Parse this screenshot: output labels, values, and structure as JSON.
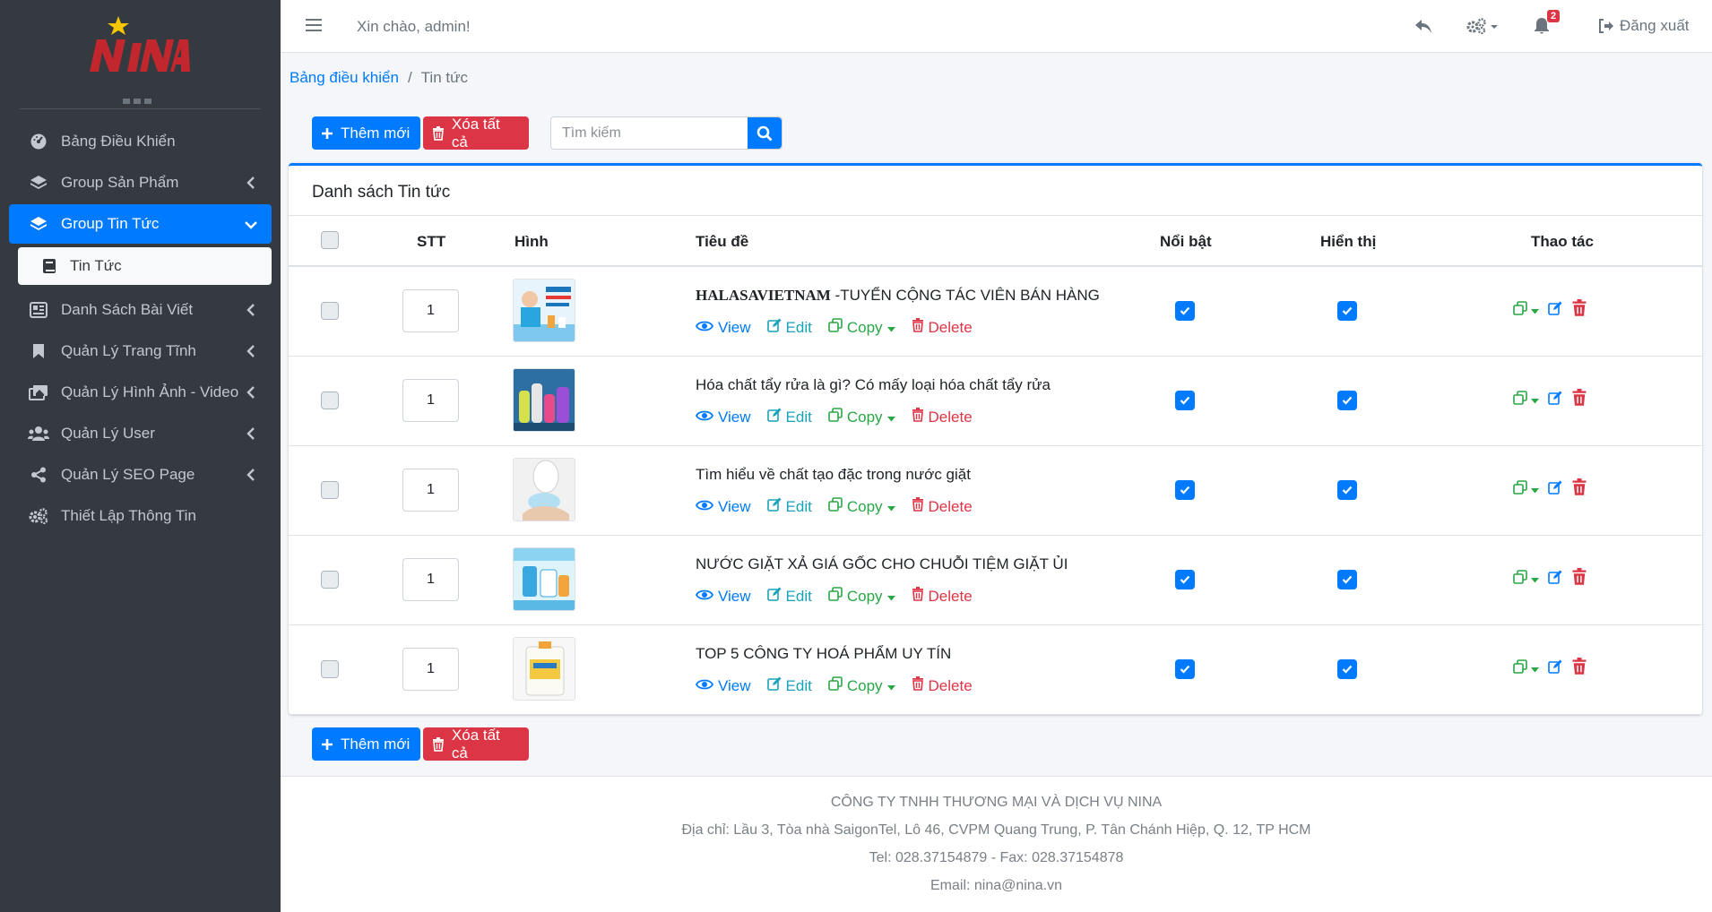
{
  "brand": {
    "logo_text": "NINA"
  },
  "sidebar": {
    "items": [
      {
        "label": "Bảng Điều Khiển",
        "icon": "dashboard-icon"
      },
      {
        "label": "Group Sản Phẩm",
        "icon": "layers-icon"
      },
      {
        "label": "Group Tin Tức",
        "icon": "layers-icon",
        "active": true
      },
      {
        "label": "Tin Tức",
        "icon": "book-icon",
        "sub": true
      },
      {
        "label": "Danh Sách Bài Viết",
        "icon": "newspaper-icon"
      },
      {
        "label": "Quản Lý Trang Tĩnh",
        "icon": "bookmark-icon"
      },
      {
        "label": "Quản Lý Hình Ảnh - Video",
        "icon": "images-icon"
      },
      {
        "label": "Quản Lý User",
        "icon": "users-icon"
      },
      {
        "label": "Quản Lý SEO Page",
        "icon": "share-icon"
      },
      {
        "label": "Thiết Lập Thông Tin",
        "icon": "cogs-icon"
      }
    ]
  },
  "topbar": {
    "greeting": "Xin chào, admin!",
    "notification_count": "2",
    "logout_label": "Đăng xuất"
  },
  "breadcrumb": {
    "home": "Bảng điều khiển",
    "current": "Tin tức"
  },
  "toolbar": {
    "add_label": "Thêm mới",
    "delete_all_label": "Xóa tất cả",
    "search_placeholder": "Tìm kiếm"
  },
  "table": {
    "title": "Danh sách Tin tức",
    "headers": {
      "stt": "STT",
      "image": "Hình",
      "title": "Tiêu đề",
      "featured": "Nổi bật",
      "visible": "Hiển thị",
      "actions": "Thao tác"
    },
    "action_labels": {
      "view": "View",
      "edit": "Edit",
      "copy": "Copy",
      "delete": "Delete"
    },
    "rows": [
      {
        "stt": "1",
        "title_bold": "HALASAVIETNAM",
        "title": " -TUYỂN CỘNG TÁC VIÊN BÁN HÀNG",
        "featured": true,
        "visible": true
      },
      {
        "stt": "1",
        "title_bold": "",
        "title": "Hóa chất tẩy rửa là gì? Có mấy loại hóa chất tẩy rửa",
        "featured": true,
        "visible": true
      },
      {
        "stt": "1",
        "title_bold": "",
        "title": "Tìm hiểu về chất tạo đặc trong nước giặt",
        "featured": true,
        "visible": true
      },
      {
        "stt": "1",
        "title_bold": "",
        "title": "NƯỚC GIẶT XẢ GIÁ GỐC CHO CHUỖI TIỆM GIẶT ỦI",
        "featured": true,
        "visible": true
      },
      {
        "stt": "1",
        "title_bold": "",
        "title": "TOP 5 CÔNG TY HOÁ PHẨM UY TÍN",
        "featured": true,
        "visible": true
      }
    ]
  },
  "footer": {
    "company": "CÔNG TY TNHH THƯƠNG MẠI VÀ DỊCH VỤ NINA",
    "address": "Địa chỉ: Lầu 3, Tòa nhà SaigonTel, Lô 46, CVPM Quang Trung, P. Tân Chánh Hiệp, Q. 12, TP HCM",
    "phone": "Tel: 028.37154879 - Fax: 028.37154878",
    "email": "Email: nina@nina.vn"
  },
  "colors": {
    "primary": "#007bff",
    "danger": "#dc3545",
    "success": "#28a745",
    "info": "#17a2b8",
    "sidebar": "#343a40"
  }
}
